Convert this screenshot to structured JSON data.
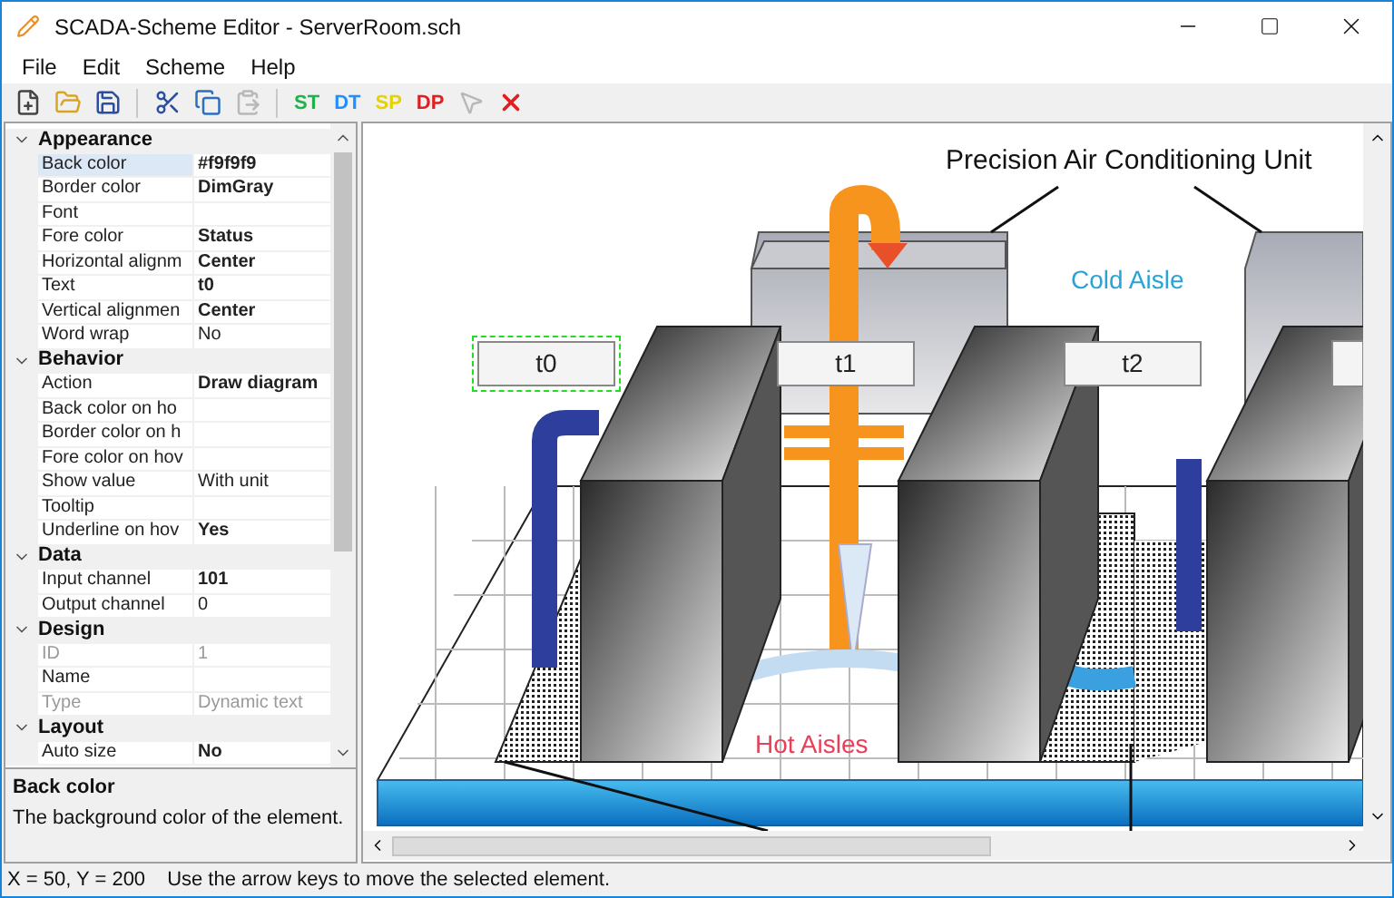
{
  "window": {
    "title": "SCADA-Scheme Editor - ServerRoom.sch"
  },
  "menu": [
    "File",
    "Edit",
    "Scheme",
    "Help"
  ],
  "toolbar": [
    {
      "kind": "icon",
      "disabled": false
    },
    {
      "kind": "icon",
      "disabled": false
    },
    {
      "kind": "icon",
      "disabled": false
    },
    {
      "kind": "separator"
    },
    {
      "kind": "icon",
      "disabled": false
    },
    {
      "kind": "icon",
      "disabled": false
    },
    {
      "kind": "icon",
      "disabled": true
    },
    {
      "kind": "separator"
    },
    {
      "kind": "text",
      "label": "ST",
      "color": "#22b14c"
    },
    {
      "kind": "text",
      "label": "DT",
      "color": "#1e90ff"
    },
    {
      "kind": "text",
      "label": "SP",
      "color": "#e6d200"
    },
    {
      "kind": "text",
      "label": "DP",
      "color": "#e02020"
    },
    {
      "kind": "icon",
      "disabled": true
    },
    {
      "kind": "icon",
      "disabled": false
    }
  ],
  "property_grid": {
    "categories": [
      {
        "name": "Appearance",
        "expanded": true,
        "properties": [
          {
            "name": "Back color",
            "value": "#f9f9f9",
            "bold": true,
            "selected": true
          },
          {
            "name": "Border color",
            "value": "DimGray",
            "bold": true,
            "selected": false
          },
          {
            "name": "Font",
            "selected": false
          },
          {
            "name": "Fore color",
            "value": "Status",
            "bold": true,
            "selected": false
          },
          {
            "name": "Horizontal alignm",
            "value": "Center",
            "bold": true,
            "selected": false
          },
          {
            "name": "Text",
            "value": "t0",
            "bold": true,
            "selected": false
          },
          {
            "name": "Vertical alignmen",
            "value": "Center",
            "bold": true,
            "selected": false
          },
          {
            "name": "Word wrap",
            "value": "No",
            "bold": false,
            "selected": false
          }
        ]
      },
      {
        "name": "Behavior",
        "expanded": true,
        "properties": [
          {
            "name": "Action",
            "value": "Draw diagram",
            "bold": true,
            "selected": false
          },
          {
            "name": "Back color on ho",
            "selected": false
          },
          {
            "name": "Border color on h",
            "selected": false
          },
          {
            "name": "Fore color on hov",
            "selected": false
          },
          {
            "name": "Show value",
            "value": "With unit",
            "bold": false,
            "selected": false
          },
          {
            "name": "Tooltip",
            "selected": false
          },
          {
            "name": "Underline on hov",
            "value": "Yes",
            "bold": true,
            "selected": false
          }
        ]
      },
      {
        "name": "Data",
        "expanded": true,
        "properties": [
          {
            "name": "Input channel",
            "value": "101",
            "bold": true,
            "selected": false
          },
          {
            "name": "Output channel",
            "value": "0",
            "bold": false,
            "selected": false
          }
        ]
      },
      {
        "name": "Design",
        "expanded": true,
        "properties": [
          {
            "name": "ID",
            "value": "1",
            "disabled": true,
            "selected": false
          },
          {
            "name": "Name",
            "selected": false
          },
          {
            "name": "Type",
            "value": "Dynamic text",
            "disabled": true,
            "selected": false
          }
        ]
      },
      {
        "name": "Layout",
        "expanded": true,
        "properties": [
          {
            "name": "Auto size",
            "value": "No",
            "bold": true,
            "selected": false
          }
        ]
      }
    ]
  },
  "description": {
    "title": "Back color",
    "text": "The background color of the element."
  },
  "scheme": {
    "elements": [
      {
        "kind": "label",
        "text": "Precision Air Conditioning Unit",
        "color": "#111111"
      },
      {
        "kind": "label",
        "text": "Cold Aisle",
        "color": "#29a3d6"
      },
      {
        "kind": "textbox",
        "text": "t0",
        "selected": true
      },
      {
        "kind": "textbox",
        "text": "t1",
        "selected": false
      },
      {
        "kind": "textbox",
        "text": "t2",
        "selected": false
      },
      {
        "kind": "label",
        "text": "Hot Aisles",
        "color": "#e8405a"
      }
    ]
  },
  "status_bar": {
    "position": "X = 50, Y = 200",
    "hint": "Use the arrow keys to move the selected element."
  }
}
